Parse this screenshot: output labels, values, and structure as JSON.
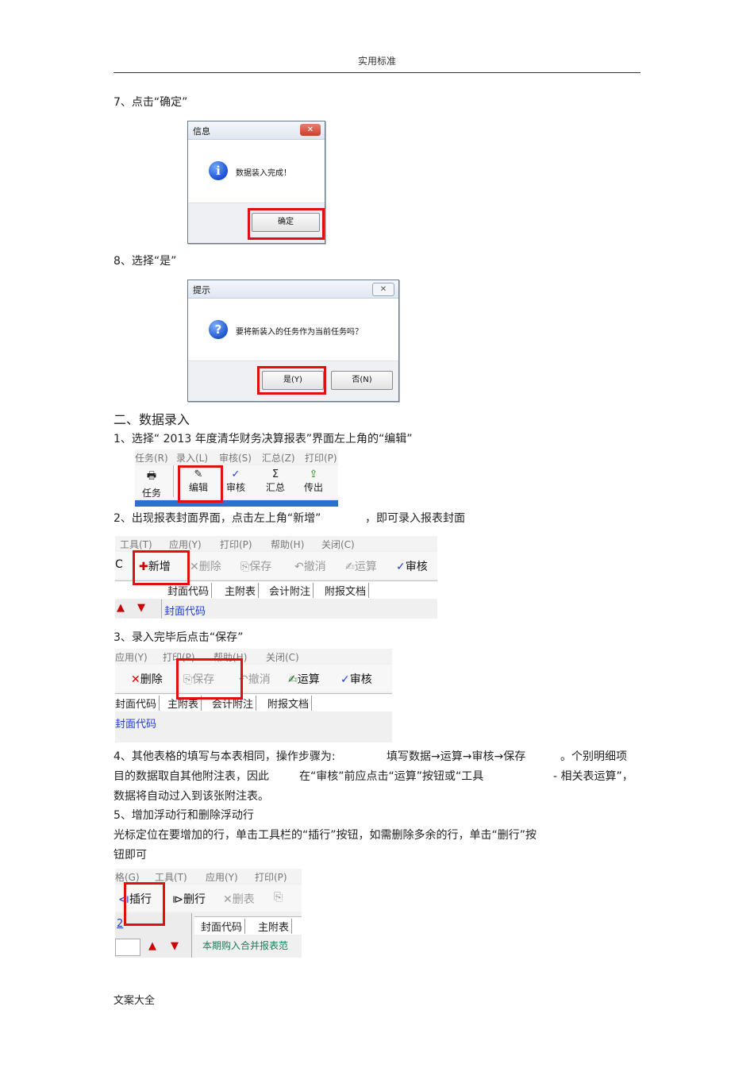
{
  "header": {
    "title": "实用标准"
  },
  "footer": {
    "text": "文案大全"
  },
  "steps": {
    "s7": "7、点击“确定”",
    "s8": "8、选择“是”",
    "section2": "二、数据录入",
    "s1": "1、选择“ 2013 年度清华财务决算报表”界面左上角的“编辑”",
    "s2a": "2、出现报表封面界面，点击左上角“新增”",
    "s2b": "，即可录入报表封面",
    "s3": "3、录入完毕后点击“保存”",
    "s4_l1a": "4、其他表格的填写与本表相同，操作步骤为:",
    "s4_l1b": "填写数据→运算→审核→保存",
    "s4_l1c": "。个别明细项",
    "s4_l2a": "目的数据取自其他附注表，因此",
    "s4_l2b": "在“审核”前应点击“运算”按钮或“工具",
    "s4_l2c": "- 相关表运算”，",
    "s4_l3": "数据将自动过入到该张附注表。",
    "s5": "5、增加浮动行和删除浮动行",
    "s5_l1": "光标定位在要增加的行，单击工具栏的“插行”按钮，如需删除多余的行，单击“删行”按",
    "s5_l2": "钮即可"
  },
  "dialog_info": {
    "title": "信息",
    "message": "数据装入完成！",
    "ok_label": "确定"
  },
  "dialog_prompt": {
    "title": "提示",
    "message": "要将新装入的任务作为当前任务吗？",
    "yes_label": "是(Y)",
    "no_label": "否(N)"
  },
  "shot1": {
    "menu": [
      "任务(R)",
      "录入(L)",
      "审核(S)",
      "汇总(Z)",
      "打印(P)"
    ],
    "tools": [
      "任务",
      "编辑",
      "审核",
      "汇总",
      "传出"
    ]
  },
  "shot2": {
    "menu": [
      "工具(T)",
      "应用(Y)",
      "打印(P)",
      "帮助(H)",
      "关闭(C)"
    ],
    "left_char": "C",
    "tools": [
      "新增",
      "删除",
      "保存",
      "撤消",
      "运算",
      "审核"
    ],
    "tabs": [
      "封面代码",
      "主附表",
      "会计附注",
      "附报文档"
    ],
    "row2": "封面代码"
  },
  "shot3": {
    "menu": [
      "应用(Y)",
      "打印(P)",
      "帮助(H)",
      "关闭(C)"
    ],
    "tools": [
      "删除",
      "保存",
      "撤消",
      "运算",
      "审核"
    ],
    "tabs": [
      "封面代码",
      "主附表",
      "会计附注",
      "附报文档"
    ],
    "row2": "封面代码"
  },
  "shot4": {
    "menu": [
      "格(G)",
      "工具(T)",
      "应用(Y)",
      "打印(P)"
    ],
    "tools": [
      "插行",
      "删行",
      "删表"
    ],
    "left_link": "2",
    "tabs": [
      "封面代码",
      "主附表"
    ],
    "row2": "本期购入合并报表范"
  },
  "colors": {
    "highlight": "#e01010",
    "link": "#1f3fd1"
  }
}
